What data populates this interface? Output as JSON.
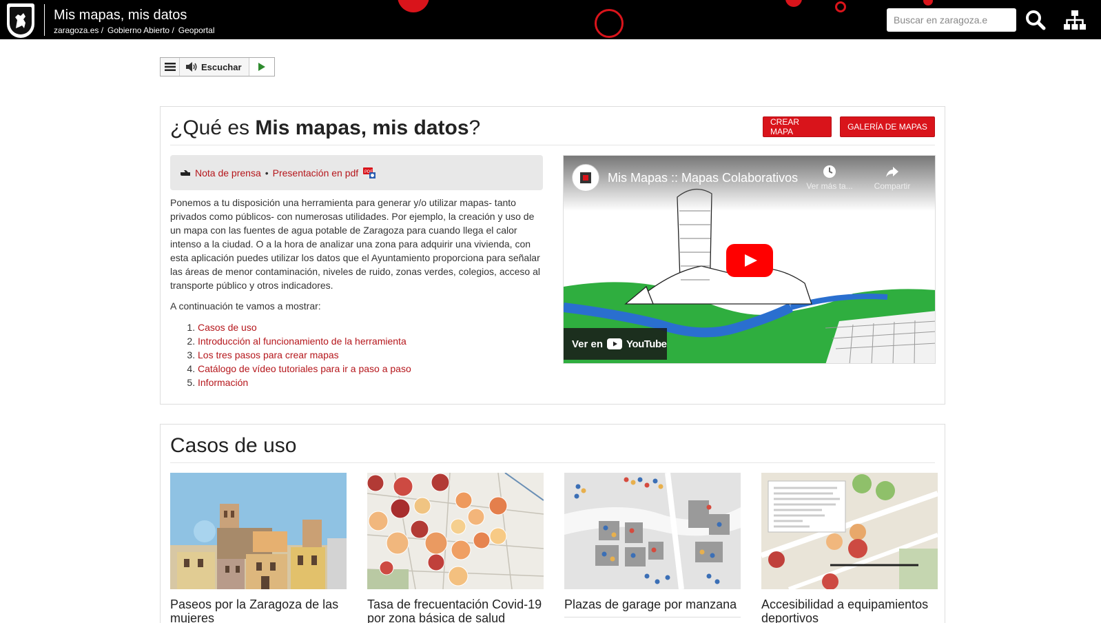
{
  "header": {
    "site_title": "Mis mapas, mis datos",
    "breadcrumbs": [
      "zaragoza.es /",
      "Gobierno Abierto /",
      "Geoportal"
    ],
    "search_placeholder": "Buscar en zaragoza.e",
    "colors": {
      "bar": "#000000",
      "accent": "#d9141b"
    }
  },
  "readspeaker": {
    "listen_label": "Escuchar"
  },
  "intro": {
    "heading_prefix": "¿Qué es ",
    "heading_bold": "Mis mapas, mis datos",
    "heading_suffix": "?",
    "btn_crear": "CREAR MAPA",
    "btn_galeria": "GALERÍA DE MAPAS",
    "note_link1": "Nota de prensa",
    "note_sep": "•",
    "note_link2": "Presentación en pdf",
    "paragraph": "Ponemos a tu disposición una herramienta para generar y/o utilizar mapas- tanto privados como públicos- con numerosas utilidades. Por ejemplo, la creación y uso de un mapa con las fuentes de agua potable de Zaragoza para cuando llega el calor intenso a la ciudad. O a la hora de analizar una zona para adquirir una vivienda, con esta aplicación puedes utilizar los datos que el Ayuntamiento proporciona para señalar las áreas de menor contaminación, niveles de ruido, zonas verdes, colegios, acceso al transporte público y otros indicadores.",
    "continue_text": "A continuación te vamos a mostrar:",
    "list": [
      "Casos de uso",
      "Introducción al funcionamiento de la herramienta",
      "Los tres pasos para crear mapas",
      "Catálogo de vídeo tutoriales para ir a paso a paso",
      "Información"
    ]
  },
  "video": {
    "title": "Mis Mapas :: Mapas Colaborativos",
    "watch_later": "Ver más ta...",
    "share": "Compartir",
    "watch_on": "Ver en",
    "youtube": "YouTube"
  },
  "casos": {
    "heading": "Casos de uso",
    "cards": [
      {
        "title": "Paseos por la Zaragoza de las mujeres"
      },
      {
        "title": "Tasa de frecuentación Covid-19 por zona básica de salud"
      },
      {
        "title": "Plazas de garage por manzana"
      },
      {
        "title": "Accesibilidad a equipamientos deportivos"
      }
    ]
  }
}
